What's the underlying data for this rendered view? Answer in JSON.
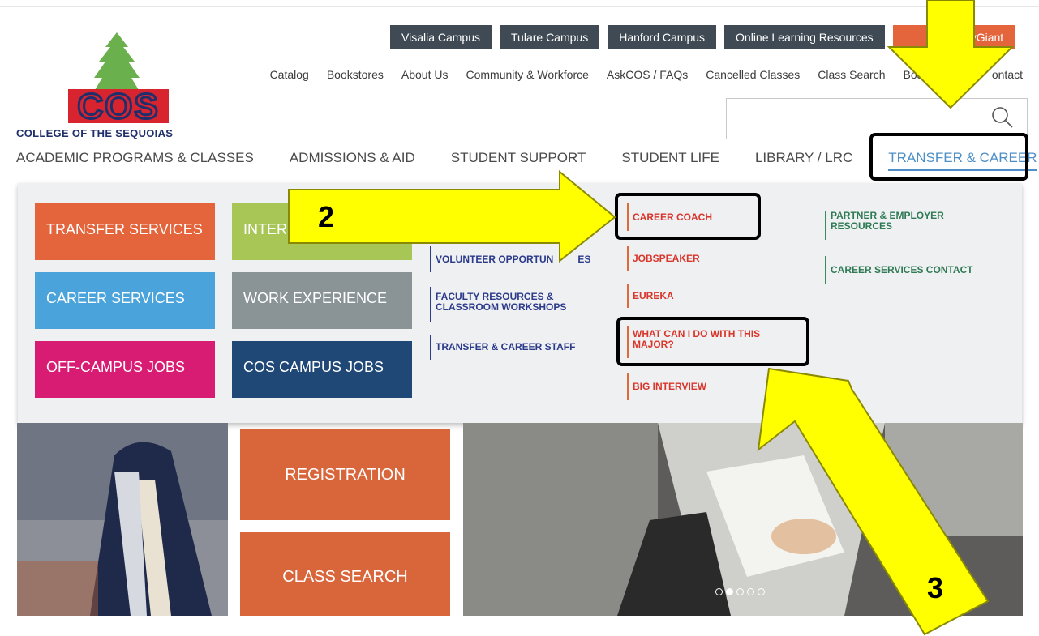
{
  "campus_links": [
    {
      "label": "Visalia Campus"
    },
    {
      "label": "Tulare Campus"
    },
    {
      "label": "Hanford Campus"
    },
    {
      "label": "Online Learning Resources"
    },
    {
      "label": "yGiant"
    }
  ],
  "utility_links": [
    "Catalog",
    "Bookstores",
    "About Us",
    "Community & Workforce",
    "AskCOS / FAQs",
    "Cancelled Classes",
    "Class Search",
    "Board",
    "ontact"
  ],
  "logo": {
    "letters": "COS",
    "tagline": "COLLEGE OF THE SEQUOIAS"
  },
  "search": {
    "placeholder": ""
  },
  "main_nav": [
    "ACADEMIC PROGRAMS & CLASSES",
    "ADMISSIONS & AID",
    "STUDENT SUPPORT",
    "STUDENT LIFE",
    "LIBRARY / LRC",
    "TRANSFER & CAREER"
  ],
  "mega_menu": {
    "tiles": [
      "TRANSFER SERVICES",
      "INTERN",
      "CAREER SERVICES",
      "WORK EXPERIENCE",
      "OFF-CAMPUS JOBS",
      "COS CAMPUS JOBS"
    ],
    "col_blue": [
      "VOLUNTEER OPPORTUN",
      "ES",
      "FACULTY RESOURCES &",
      "CLASSROOM WORKSHOPS",
      "TRANSFER & CAREER STAFF"
    ],
    "col_red": [
      "CAREER COACH",
      "JOBSPEAKER",
      "EUREKA",
      "WHAT CAN I DO WITH THIS",
      "MAJOR?",
      "BIG INTERVIEW"
    ],
    "col_green": [
      "PARTNER & EMPLOYER",
      "RESOURCES",
      "CAREER SERVICES CONTACT"
    ]
  },
  "hero": {
    "tiles": [
      "REGISTRATION",
      "CLASS SEARCH"
    ],
    "slide_index": 2,
    "slide_count": 5
  },
  "callouts": [
    "2",
    "3"
  ],
  "colors": {
    "accent_blue": "#4e8fc7",
    "orange": "#e4643c",
    "annotation_yellow": "#ffff00"
  }
}
